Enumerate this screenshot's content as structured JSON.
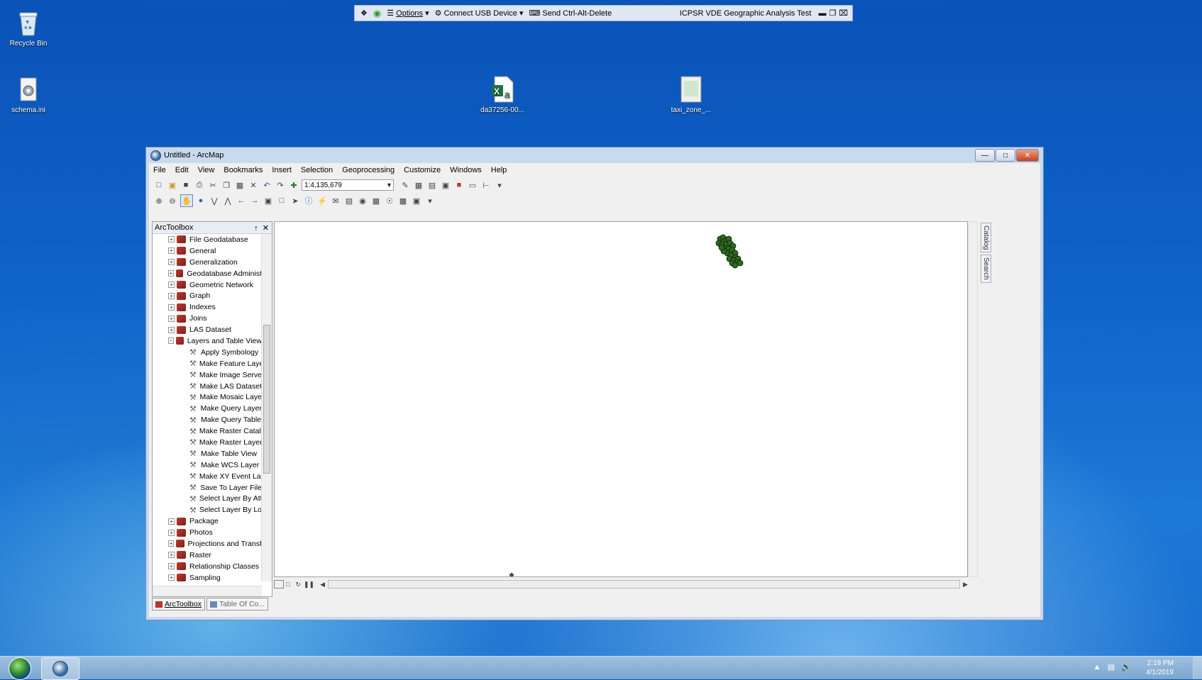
{
  "desktop": {
    "icons": [
      {
        "label": "Recycle Bin"
      },
      {
        "label": "schema.ini"
      },
      {
        "label": "da37256-00..."
      },
      {
        "label": "taxi_zone_..."
      }
    ]
  },
  "remote_bar": {
    "options": "Options",
    "connect_usb": "Connect USB Device",
    "send_cad": "Send Ctrl-Alt-Delete",
    "title": "ICPSR VDE Geographic Analysis Test"
  },
  "window": {
    "title": "Untitled - ArcMap",
    "menu": [
      "File",
      "Edit",
      "View",
      "Bookmarks",
      "Insert",
      "Selection",
      "Geoprocessing",
      "Customize",
      "Windows",
      "Help"
    ],
    "scale": "1:4,135,679"
  },
  "toolbox": {
    "title": "ArcToolbox",
    "pin": "↑",
    "close": "✕",
    "items": [
      {
        "label": "File Geodatabase",
        "type": "toolbox",
        "toggle": "+"
      },
      {
        "label": "General",
        "type": "toolbox",
        "toggle": "+"
      },
      {
        "label": "Generalization",
        "type": "toolbox",
        "toggle": "+"
      },
      {
        "label": "Geodatabase Administ",
        "type": "toolbox",
        "toggle": "+"
      },
      {
        "label": "Geometric Network",
        "type": "toolbox",
        "toggle": "+"
      },
      {
        "label": "Graph",
        "type": "toolbox",
        "toggle": "+"
      },
      {
        "label": "Indexes",
        "type": "toolbox",
        "toggle": "+"
      },
      {
        "label": "Joins",
        "type": "toolbox",
        "toggle": "+"
      },
      {
        "label": "LAS Dataset",
        "type": "toolbox",
        "toggle": "+"
      },
      {
        "label": "Layers and Table View",
        "type": "toolbox",
        "toggle": "−"
      },
      {
        "label": "Apply Symbology",
        "type": "tool"
      },
      {
        "label": "Make Feature Laye",
        "type": "tool"
      },
      {
        "label": "Make Image Server",
        "type": "tool"
      },
      {
        "label": "Make LAS Dataset",
        "type": "tool"
      },
      {
        "label": "Make Mosaic Laye",
        "type": "tool"
      },
      {
        "label": "Make Query Layer",
        "type": "tool"
      },
      {
        "label": "Make Query Table",
        "type": "tool"
      },
      {
        "label": "Make Raster Catalc",
        "type": "tool"
      },
      {
        "label": "Make Raster Layer",
        "type": "tool"
      },
      {
        "label": "Make Table View",
        "type": "tool"
      },
      {
        "label": "Make WCS Layer",
        "type": "tool"
      },
      {
        "label": "Make XY Event Lay",
        "type": "tool"
      },
      {
        "label": "Save To Layer File",
        "type": "tool"
      },
      {
        "label": "Select Layer By Att",
        "type": "tool"
      },
      {
        "label": "Select Layer By Loc",
        "type": "tool"
      },
      {
        "label": "Package",
        "type": "toolbox",
        "toggle": "+"
      },
      {
        "label": "Photos",
        "type": "toolbox",
        "toggle": "+"
      },
      {
        "label": "Projections and Transf",
        "type": "toolbox",
        "toggle": "+"
      },
      {
        "label": "Raster",
        "type": "toolbox",
        "toggle": "+"
      },
      {
        "label": "Relationship Classes",
        "type": "toolbox",
        "toggle": "+"
      },
      {
        "label": "Sampling",
        "type": "toolbox",
        "toggle": "+"
      }
    ],
    "tabs": [
      {
        "label": "ArcToolbox"
      },
      {
        "label": "Table Of Co..."
      }
    ]
  },
  "side_tabs": [
    "Catalog",
    "Search"
  ],
  "taskbar": {
    "time": "2:19 PM",
    "date": "4/1/2019"
  },
  "colors": {
    "point_cluster": "#2e6b1e",
    "outline": "#0c1a08"
  }
}
